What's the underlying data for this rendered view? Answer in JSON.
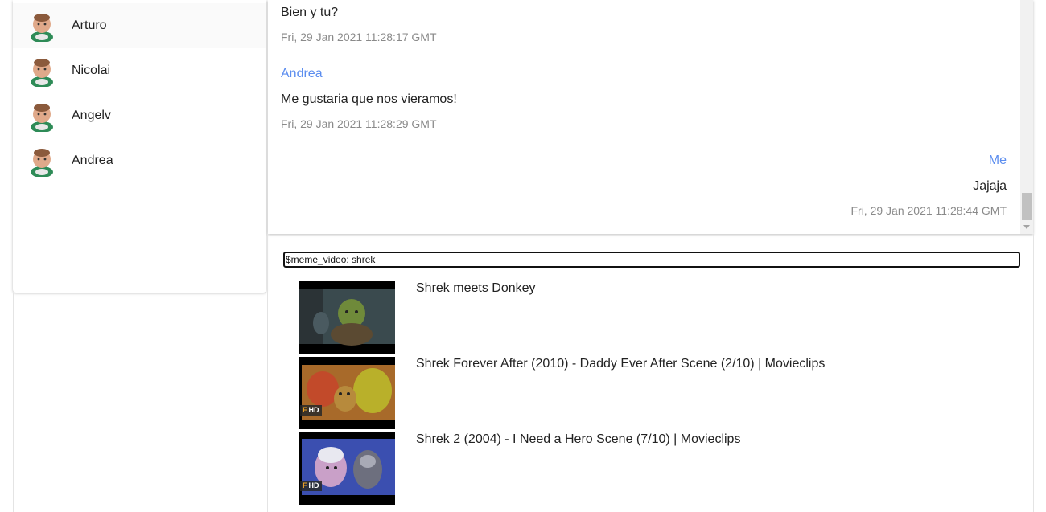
{
  "contacts": [
    {
      "name": "Arturo"
    },
    {
      "name": "Nicolai"
    },
    {
      "name": "Angelv"
    },
    {
      "name": "Andrea"
    }
  ],
  "messages": [
    {
      "author": "",
      "text": "Bien y tu?",
      "time": "Fri, 29 Jan 2021 11:28:17 GMT",
      "align": "left"
    },
    {
      "author": "Andrea",
      "text": "Me gustaria que nos vieramos!",
      "time": "Fri, 29 Jan 2021 11:28:29 GMT",
      "align": "left"
    },
    {
      "author": "Me",
      "text": "Jajaja",
      "time": "Fri, 29 Jan 2021 11:28:44 GMT",
      "align": "right"
    }
  ],
  "composer": {
    "value": "$meme_video: shrek"
  },
  "results": [
    {
      "title": "Shrek meets Donkey",
      "hd": false
    },
    {
      "title": "Shrek Forever After (2010) - Daddy Ever After Scene (2/10) | Movieclips",
      "hd": true,
      "badge": "HD"
    },
    {
      "title": "Shrek 2 (2004) - I Need a Hero Scene (7/10) | Movieclips",
      "hd": true,
      "badge": "HD"
    }
  ],
  "colors": {
    "accent": "#5b8def"
  }
}
